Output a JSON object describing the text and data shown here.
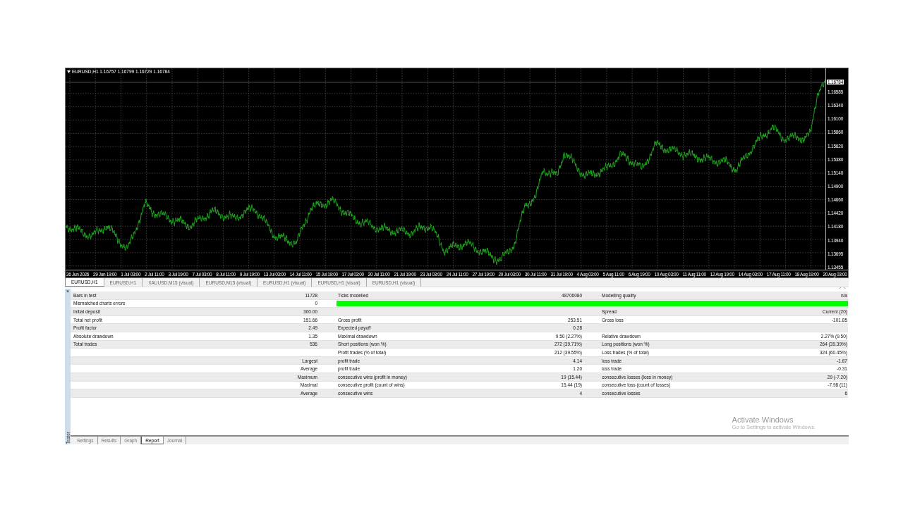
{
  "chart": {
    "title": "EURUSD,H1  1.16757 1.16799 1.16729 1.16784",
    "current_price": "1.16784",
    "price_labels": [
      "1.16585",
      "1.16340",
      "1.16100",
      "1.15860",
      "1.15620",
      "1.15380",
      "1.15140",
      "1.14900",
      "1.14660",
      "1.14420",
      "1.14180",
      "1.13940",
      "1.13695",
      "1.13455"
    ],
    "time_labels": [
      "26 Jun 2026",
      "29 Jun 19:00",
      "1 Jul 03:00",
      "2 Jul 11:00",
      "3 Jul 19:00",
      "7 Jul 03:00",
      "8 Jul 11:00",
      "9 Jul 19:00",
      "13 Jul 03:00",
      "14 Jul 11:00",
      "15 Jul 19:00",
      "17 Jul 03:00",
      "20 Jul 11:00",
      "21 Jul 19:00",
      "23 Jul 03:00",
      "24 Jul 11:00",
      "27 Jul 19:00",
      "29 Jul 03:00",
      "30 Jul 11:00",
      "31 Jul 19:00",
      "4 Aug 03:00",
      "5 Aug 11:00",
      "6 Aug 19:00",
      "10 Aug 03:00",
      "11 Aug 11:00",
      "12 Aug 19:00",
      "14 Aug 03:00",
      "17 Aug 11:00",
      "18 Aug 19:00",
      "20 Aug 03:00"
    ]
  },
  "chart_tabs": [
    {
      "label": "EURUSD,H1",
      "selected": true
    },
    {
      "label": "EURUSD,H1",
      "selected": false
    },
    {
      "label": "XAUUSD,M15 (visual)",
      "selected": false
    },
    {
      "label": "EURUSD,M15 (visual)",
      "selected": false
    },
    {
      "label": "EURUSD,H1 (visual)",
      "selected": false
    },
    {
      "label": "EURUSD,H1 (visual)",
      "selected": false
    },
    {
      "label": "EURUSD,H1 (visual)",
      "selected": false
    }
  ],
  "report": {
    "rows": [
      {
        "label": "Bars in test",
        "value": "11728",
        "label_2": "Ticks modelled",
        "value_2": "48706080",
        "label_3": "Modelling quality",
        "value_3": "n/a"
      },
      {
        "label": "Mismatched charts errors",
        "value": "0",
        "quality_bar": {
          "level": 1
        }
      },
      {
        "label": "Initial deposit",
        "value": "300.00",
        "label_3": "Spread",
        "value_3": "Current (20)"
      },
      {
        "label": "Total net profit",
        "value": "151.66",
        "label_2": "Gross profit",
        "value_2": "253.51",
        "label_3": "Gross loss",
        "value_3": "-101.85"
      },
      {
        "label": "Profit factor",
        "value": "2.49",
        "label_2": "Expected payoff",
        "value_2": "0.28"
      },
      {
        "label": "Absolute drawdown",
        "value": "1.35",
        "label_2": "Maximal drawdown",
        "value_2": "9.50 (2.27%)",
        "label_3": "Relative drawdown",
        "value_3": "2.27% (9.50)"
      },
      {
        "label": "Total trades",
        "value": "536",
        "label_2": "Short positions (won %)",
        "value_2": "272 (39.71%)",
        "label_3": "Long positions (won %)",
        "value_3": "264 (39.39%)"
      },
      {
        "label_2": "Profit trades (% of total)",
        "value_2": "212 (39.55%)",
        "label_3": "Loss trades (% of total)",
        "value_3": "324 (60.45%)"
      },
      {
        "value": "Largest",
        "label_2": "profit trade",
        "value_2": "4.14",
        "label_3": "loss trade",
        "value_3": "-1.67"
      },
      {
        "value": "Average",
        "label_2": "profit trade",
        "value_2": "1.20",
        "label_3": "loss trade",
        "value_3": "-0.31"
      },
      {
        "value": "Maximum",
        "label_2": "consecutive wins (profit in money)",
        "value_2": "19 (15.44)",
        "label_3": "consecutive losses (loss in money)",
        "value_3": "29 (-7.20)"
      },
      {
        "value": "Maximal",
        "label_2": "consecutive profit (count of wins)",
        "value_2": "15.44 (19)",
        "label_3": "consecutive loss (count of losses)",
        "value_3": "-7.98 (11)"
      },
      {
        "value": "Average",
        "label_2": "consecutive wins",
        "value_2": "4",
        "label_3": "consecutive losses",
        "value_3": "6"
      }
    ]
  },
  "tester": {
    "close": "×",
    "title": "Tester",
    "tabs": [
      {
        "label": "Settings",
        "selected": false
      },
      {
        "label": "Results",
        "selected": false
      },
      {
        "label": "Graph",
        "selected": false
      },
      {
        "label": "Report",
        "selected": true
      },
      {
        "label": "Journal",
        "selected": false
      }
    ]
  },
  "os_notice": {
    "title": "Activate Windows",
    "text": "Go to Settings to activate Windows."
  }
}
